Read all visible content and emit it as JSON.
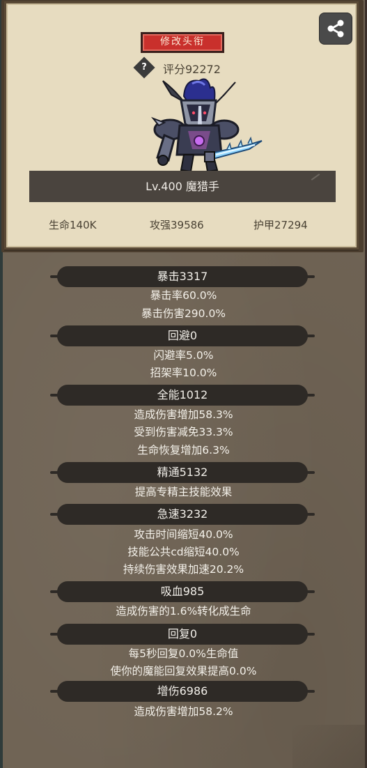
{
  "header": {
    "title_button": "修改头衔",
    "help_symbol": "?",
    "score": "评分92272"
  },
  "hero": {
    "level_name": "Lv.400 魔猎手",
    "stats": [
      {
        "label": "生命140K"
      },
      {
        "label": "攻强39586"
      },
      {
        "label": "护甲27294"
      }
    ]
  },
  "attributes": [
    {
      "header": "暴击3317",
      "lines": [
        "暴击率60.0%",
        "暴击伤害290.0%"
      ]
    },
    {
      "header": "回避0",
      "lines": [
        "闪避率5.0%",
        "招架率10.0%"
      ]
    },
    {
      "header": "全能1012",
      "lines": [
        "造成伤害增加58.3%",
        "受到伤害减免33.3%",
        "生命恢复增加6.3%"
      ]
    },
    {
      "header": "精通5132",
      "lines": [
        "提高专精主技能效果"
      ]
    },
    {
      "header": "急速3232",
      "lines": [
        "攻击时间缩短40.0%",
        "技能公共cd缩短40.0%",
        "持续伤害效果加速20.2%"
      ]
    },
    {
      "header": "吸血985",
      "lines": [
        "造成伤害的1.6%转化成生命"
      ]
    },
    {
      "header": "回复0",
      "lines": [
        "每5秒回复0.0%生命值",
        "使你的魔能回复效果提高0.0%"
      ]
    },
    {
      "header": "增伤6986",
      "lines": [
        "造成伤害增加58.2%"
      ]
    }
  ],
  "icons": {
    "share": "share-icon",
    "help": "question-icon",
    "hero": "hero-character"
  },
  "colors": {
    "title_button": "#c9302c",
    "parchment": "#e7dcc0",
    "background": "#6f6354",
    "header_pill": "#2e2a26"
  }
}
